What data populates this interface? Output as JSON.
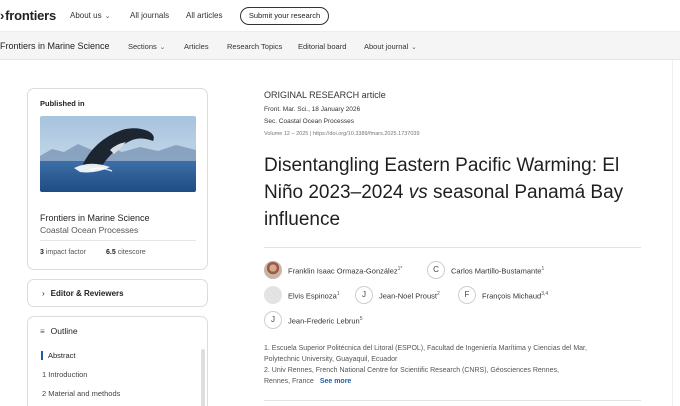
{
  "topnav": {
    "logo": "frontiers",
    "links": [
      {
        "label": "About us",
        "chevron": true
      },
      {
        "label": "All journals",
        "chevron": false
      },
      {
        "label": "All articles",
        "chevron": false
      }
    ],
    "submit_label": "Submit your research"
  },
  "journal_nav": {
    "title": "Frontiers in Marine Science",
    "links": [
      {
        "label": "Sections",
        "chevron": true
      },
      {
        "label": "Articles",
        "chevron": false
      },
      {
        "label": "Research Topics",
        "chevron": false
      },
      {
        "label": "Editorial board",
        "chevron": false
      },
      {
        "label": "About journal",
        "chevron": true
      }
    ]
  },
  "published_in": {
    "heading": "Published in",
    "journal": "Frontiers in Marine Science",
    "section": "Coastal Ocean Processes",
    "impact_value": "3",
    "impact_label": "impact factor",
    "citescore_value": "6.5",
    "citescore_label": "citescore"
  },
  "editors": {
    "label": "Editor & Reviewers"
  },
  "outline": {
    "heading": "Outline",
    "items": [
      "Abstract",
      "1 Introduction",
      "2 Material and methods"
    ]
  },
  "article": {
    "type": "ORIGINAL RESEARCH article",
    "date_line": "Front. Mar. Sci., 18 January 2026",
    "section_line": "Sec. Coastal Ocean Processes",
    "doi_line": "Volume 12 – 2025 | https://doi.org/10.3389/fmars.2025.1737039",
    "title_part1": "Disentangling Eastern Pacific Warming: El Niño 2023–2024 ",
    "title_vs": "vs",
    "title_part2": " seasonal Panamá Bay influence"
  },
  "authors": [
    {
      "name": "Franklin Isaac Ormaza-González",
      "sup": "1*",
      "avatar": "photo",
      "initial": ""
    },
    {
      "name": "Carlos Martillo-Bustamante",
      "sup": "1",
      "avatar": "initial",
      "initial": "C"
    },
    {
      "name": "Elvis Espinoza",
      "sup": "1",
      "avatar": "blank",
      "initial": ""
    },
    {
      "name": "Jean-Noel Proust",
      "sup": "2",
      "avatar": "initial",
      "initial": "J"
    },
    {
      "name": "François Michaud",
      "sup": "3,4",
      "avatar": "initial",
      "initial": "F"
    },
    {
      "name": "Jean-Frederic Lebrun",
      "sup": "5",
      "avatar": "initial",
      "initial": "J"
    }
  ],
  "affiliations": {
    "aff1_line1": "1. Escuela Superior Politécnica del Litoral (ESPOL), Facultad de Ingeniería Marítima y Ciencias del Mar,",
    "aff1_line2": "Polytechnic University, Guayaquil, Ecuador",
    "aff2_line1": "2. Univ Rennes, French National Centre for Scientific Research (CNRS), Géosciences Rennes,",
    "aff2_line2": "Rennes, France",
    "see_more": "See more"
  }
}
